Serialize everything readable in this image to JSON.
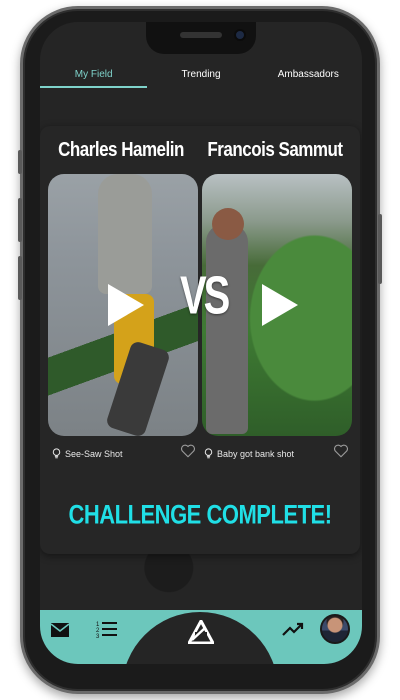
{
  "tabs": [
    {
      "label": "My Field",
      "active": true
    },
    {
      "label": "Trending",
      "active": false
    },
    {
      "label": "Ambassadors",
      "active": false
    }
  ],
  "challenge": {
    "player1": {
      "name": "Charles Hamelin",
      "shot": "See-Saw Shot"
    },
    "player2": {
      "name": "Francois Sammut",
      "shot": "Baby got bank shot"
    },
    "vs_label": "VS",
    "status": "CHALLENGE COMPLETE!"
  },
  "bottom_nav": {
    "items": [
      "mail-icon",
      "list-icon",
      "logo-icon",
      "trending-icon",
      "avatar"
    ]
  },
  "colors": {
    "accent": "#7fd3cb",
    "nav_bar": "#6cc7bc",
    "challenge_text": "#20dfe6",
    "background": "#252525"
  }
}
